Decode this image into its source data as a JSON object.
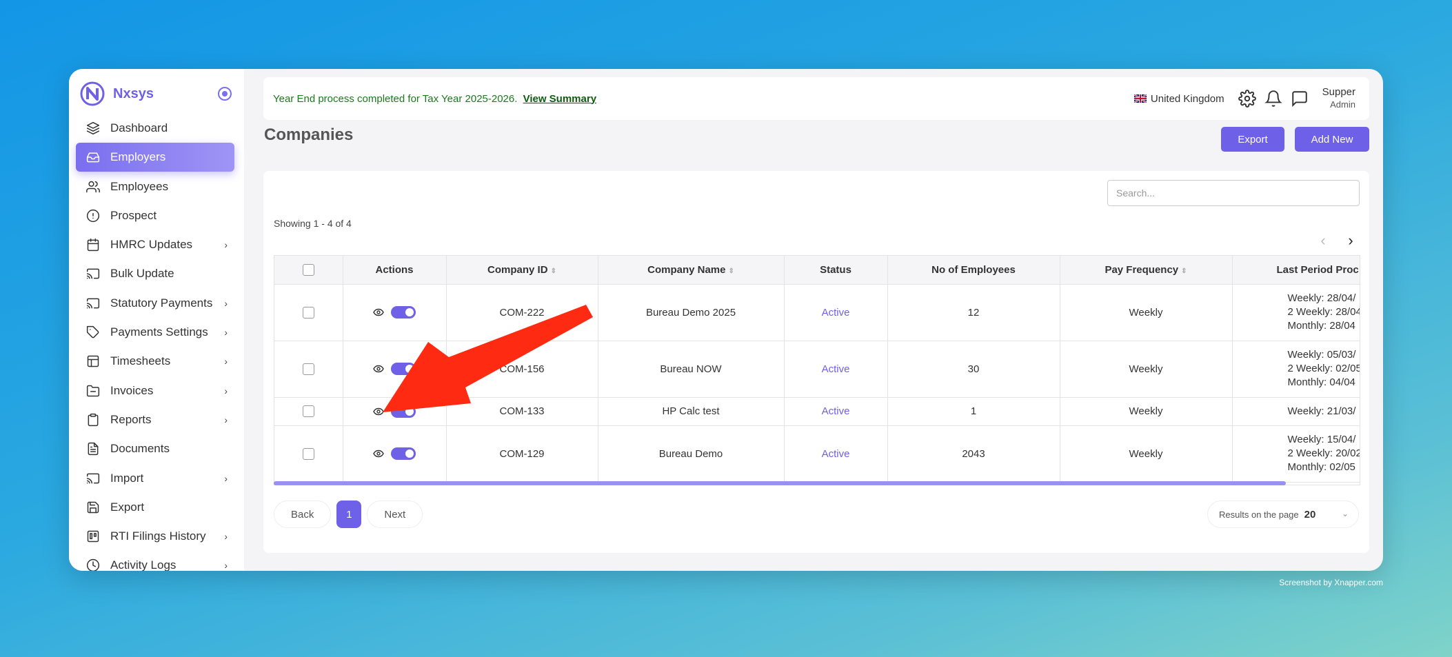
{
  "brand": {
    "name": "Nxsys"
  },
  "sidebar": {
    "items": [
      {
        "label": "Dashboard",
        "icon": "layers-icon",
        "chevron": false,
        "active": false
      },
      {
        "label": "Employers",
        "icon": "inbox-icon",
        "chevron": false,
        "active": true
      },
      {
        "label": "Employees",
        "icon": "users-icon",
        "chevron": false,
        "active": false
      },
      {
        "label": "Prospect",
        "icon": "alert-circle-icon",
        "chevron": false,
        "active": false
      },
      {
        "label": "HMRC Updates",
        "icon": "calendar-icon",
        "chevron": true,
        "active": false
      },
      {
        "label": "Bulk Update",
        "icon": "cast-icon",
        "chevron": false,
        "active": false
      },
      {
        "label": "Statutory Payments",
        "icon": "cast-icon",
        "chevron": true,
        "active": false
      },
      {
        "label": "Payments Settings",
        "icon": "tag-icon",
        "chevron": true,
        "active": false
      },
      {
        "label": "Timesheets",
        "icon": "grid-icon",
        "chevron": true,
        "active": false
      },
      {
        "label": "Invoices",
        "icon": "folder-icon",
        "chevron": true,
        "active": false
      },
      {
        "label": "Reports",
        "icon": "clipboard-icon",
        "chevron": true,
        "active": false
      },
      {
        "label": "Documents",
        "icon": "file-icon",
        "chevron": false,
        "active": false
      },
      {
        "label": "Import",
        "icon": "cast-icon",
        "chevron": true,
        "active": false
      },
      {
        "label": "Export",
        "icon": "save-icon",
        "chevron": false,
        "active": false
      },
      {
        "label": "RTI Filings History",
        "icon": "trello-icon",
        "chevron": true,
        "active": false
      },
      {
        "label": "Activity Logs",
        "icon": "clock-icon",
        "chevron": true,
        "active": false
      }
    ]
  },
  "topbar": {
    "notice": "Year End process completed for Tax Year 2025-2026.",
    "notice_link": "View Summary",
    "country": "United Kingdom",
    "user_name": "Supper",
    "user_role": "Admin"
  },
  "page": {
    "title": "Companies",
    "export_label": "Export",
    "add_label": "Add New"
  },
  "search": {
    "placeholder": "Search..."
  },
  "table": {
    "showing": "Showing 1 - 4 of 4",
    "headers": {
      "actions": "Actions",
      "company_id": "Company ID",
      "company_name": "Company Name",
      "status": "Status",
      "employees": "No of Employees",
      "pay_frequency": "Pay Frequency",
      "last_period": "Last Period Proc"
    },
    "rows": [
      {
        "company_id": "COM-222",
        "company_name": "Bureau Demo 2025",
        "status": "Active",
        "employees": "12",
        "pay_frequency": "Weekly",
        "last_period": [
          "Weekly: 28/04/",
          "2 Weekly: 28/04",
          "Monthly: 28/04"
        ]
      },
      {
        "company_id": "COM-156",
        "company_name": "Bureau NOW",
        "status": "Active",
        "employees": "30",
        "pay_frequency": "Weekly",
        "last_period": [
          "Weekly: 05/03/",
          "2 Weekly: 02/05",
          "Monthly: 04/04"
        ]
      },
      {
        "company_id": "COM-133",
        "company_name": "HP Calc test",
        "status": "Active",
        "employees": "1",
        "pay_frequency": "Weekly",
        "last_period": [
          "Weekly: 21/03/"
        ]
      },
      {
        "company_id": "COM-129",
        "company_name": "Bureau Demo",
        "status": "Active",
        "employees": "2043",
        "pay_frequency": "Weekly",
        "last_period": [
          "Weekly: 15/04/",
          "2 Weekly: 20/02",
          "Monthly: 02/05"
        ]
      }
    ]
  },
  "pagination": {
    "back": "Back",
    "page": "1",
    "next": "Next",
    "rpp_label": "Results on the page",
    "rpp_value": "20"
  },
  "credit": "Screenshot by Xnapper.com",
  "colors": {
    "accent": "#6f60e8",
    "notice": "#1a7a1a",
    "arrow": "#ff2a12"
  }
}
